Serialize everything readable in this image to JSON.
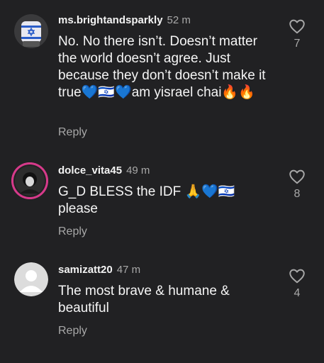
{
  "comments": [
    {
      "username": "ms.brightandsparkly",
      "time": "52 m",
      "text": "No. No there isn’t. Doesn’t matter the world doesn’t agree. Just because they don’t doesn’t make it true💙🇮🇱💙am yisrael chai🔥🔥",
      "reply_label": "Reply",
      "likes": "7",
      "like_icon": "heart-outline-icon"
    },
    {
      "username": "dolce_vita45",
      "time": "49 m",
      "text": "G_D BLESS the IDF 🙏💙🇮🇱 please",
      "reply_label": "Reply",
      "likes": "8",
      "like_icon": "heart-outline-icon"
    },
    {
      "username": "samizatt20",
      "time": "47 m",
      "text": "The most brave & humane & beautiful",
      "reply_label": "Reply",
      "likes": "4",
      "like_icon": "heart-outline-icon"
    }
  ],
  "colors": {
    "background": "#212123",
    "text": "#f5f5f5",
    "muted": "#a8a8a8",
    "story_ring": "#d63a8a"
  }
}
